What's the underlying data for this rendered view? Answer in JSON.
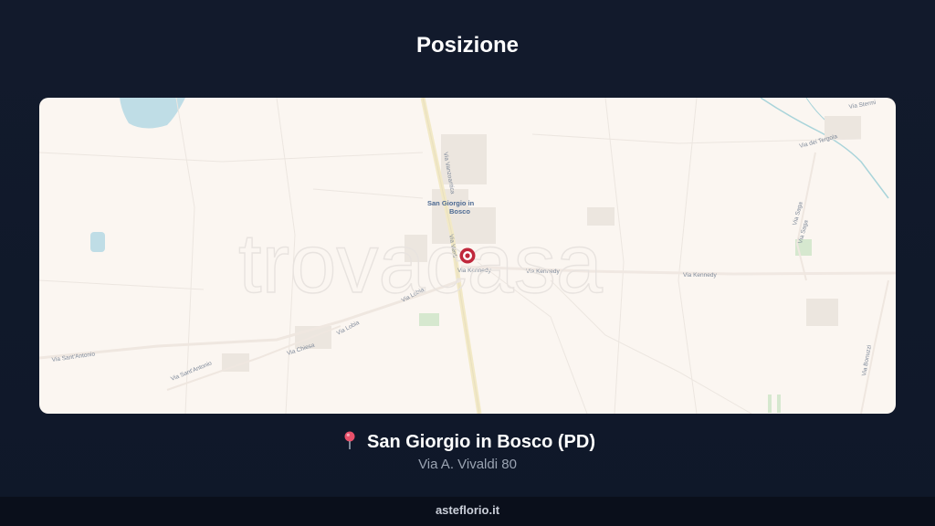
{
  "header": {
    "title": "Posizione"
  },
  "map": {
    "town_label_line1": "San Giorgio in",
    "town_label_line2": "Bosco",
    "watermark": "trovacasa",
    "roads": {
      "via_kennedy": "Via Kennedy",
      "via_vanzo": "Via Vanzoantica",
      "via_verdi": "Via Verdi",
      "via_lobia": "Via Lobia",
      "via_chiesa": "Via Chiesa",
      "via_sant_antonio": "Via Sant'Antonio",
      "via_saga": "Via Saga",
      "via_bonuzzi": "Via Bonuzzi",
      "via_stermi": "Via Stermi",
      "via_dei_tergola": "Via dei Tergola"
    },
    "marker_color": "#c0283c"
  },
  "location": {
    "name": "San Giorgio in Bosco (PD)",
    "address": "Via A. Vivaldi 80"
  },
  "footer": {
    "site": "asteflorio.it"
  }
}
